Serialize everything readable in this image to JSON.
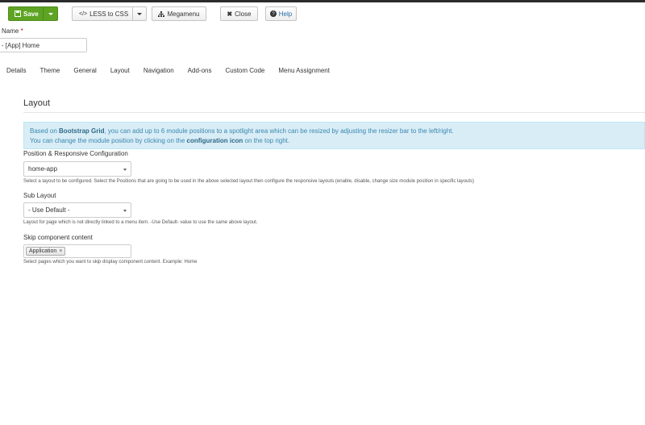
{
  "toolbar": {
    "save_label": "Save",
    "less_label": "LESS to CSS",
    "mega_label": "Megamenu",
    "close_label": "Close",
    "help_label": "Help"
  },
  "form": {
    "name_label": "Name",
    "name_required_mark": "*",
    "name_value": "r - [App] Home"
  },
  "tabs": [
    "Details",
    "Theme",
    "General",
    "Layout",
    "Navigation",
    "Add-ons",
    "Custom Code",
    "Menu Assignment"
  ],
  "layout": {
    "title": "Layout",
    "info": {
      "line1_pre": "Based on ",
      "line1_bold": "Bootstrap Grid",
      "line1_post": ", you can add up to 6 module positions to a spotlight area which can be resized by adjusting the resizer bar to the left/right.",
      "line2_pre": "You can change the module position by clicking on the ",
      "line2_bold": "configuration icon",
      "line2_post": " on the top right."
    },
    "position_label": "Position & Responsive Configuration",
    "position_value": "home-app",
    "position_help": "Select a layout to be configured. Select the Positions that are going to be used in the above selected layout then configure the responsive layouts (enable, disable, change size module position in specific layouts)",
    "sublayout_label": "Sub Layout",
    "sublayout_value": "- Use Default -",
    "sublayout_help": "Layout for page which is not directly linked to a menu item. -Use Default- value to use the same above layout.",
    "skip_label": "Skip component content",
    "skip_tag": "Application",
    "skip_tag_remove": "×",
    "skip_help": "Select pages which you want to skip display component content. Example: Home"
  },
  "colors": {
    "save_green": "#5da423",
    "info_bg": "#d9edf7",
    "info_text": "#3a87ad"
  }
}
